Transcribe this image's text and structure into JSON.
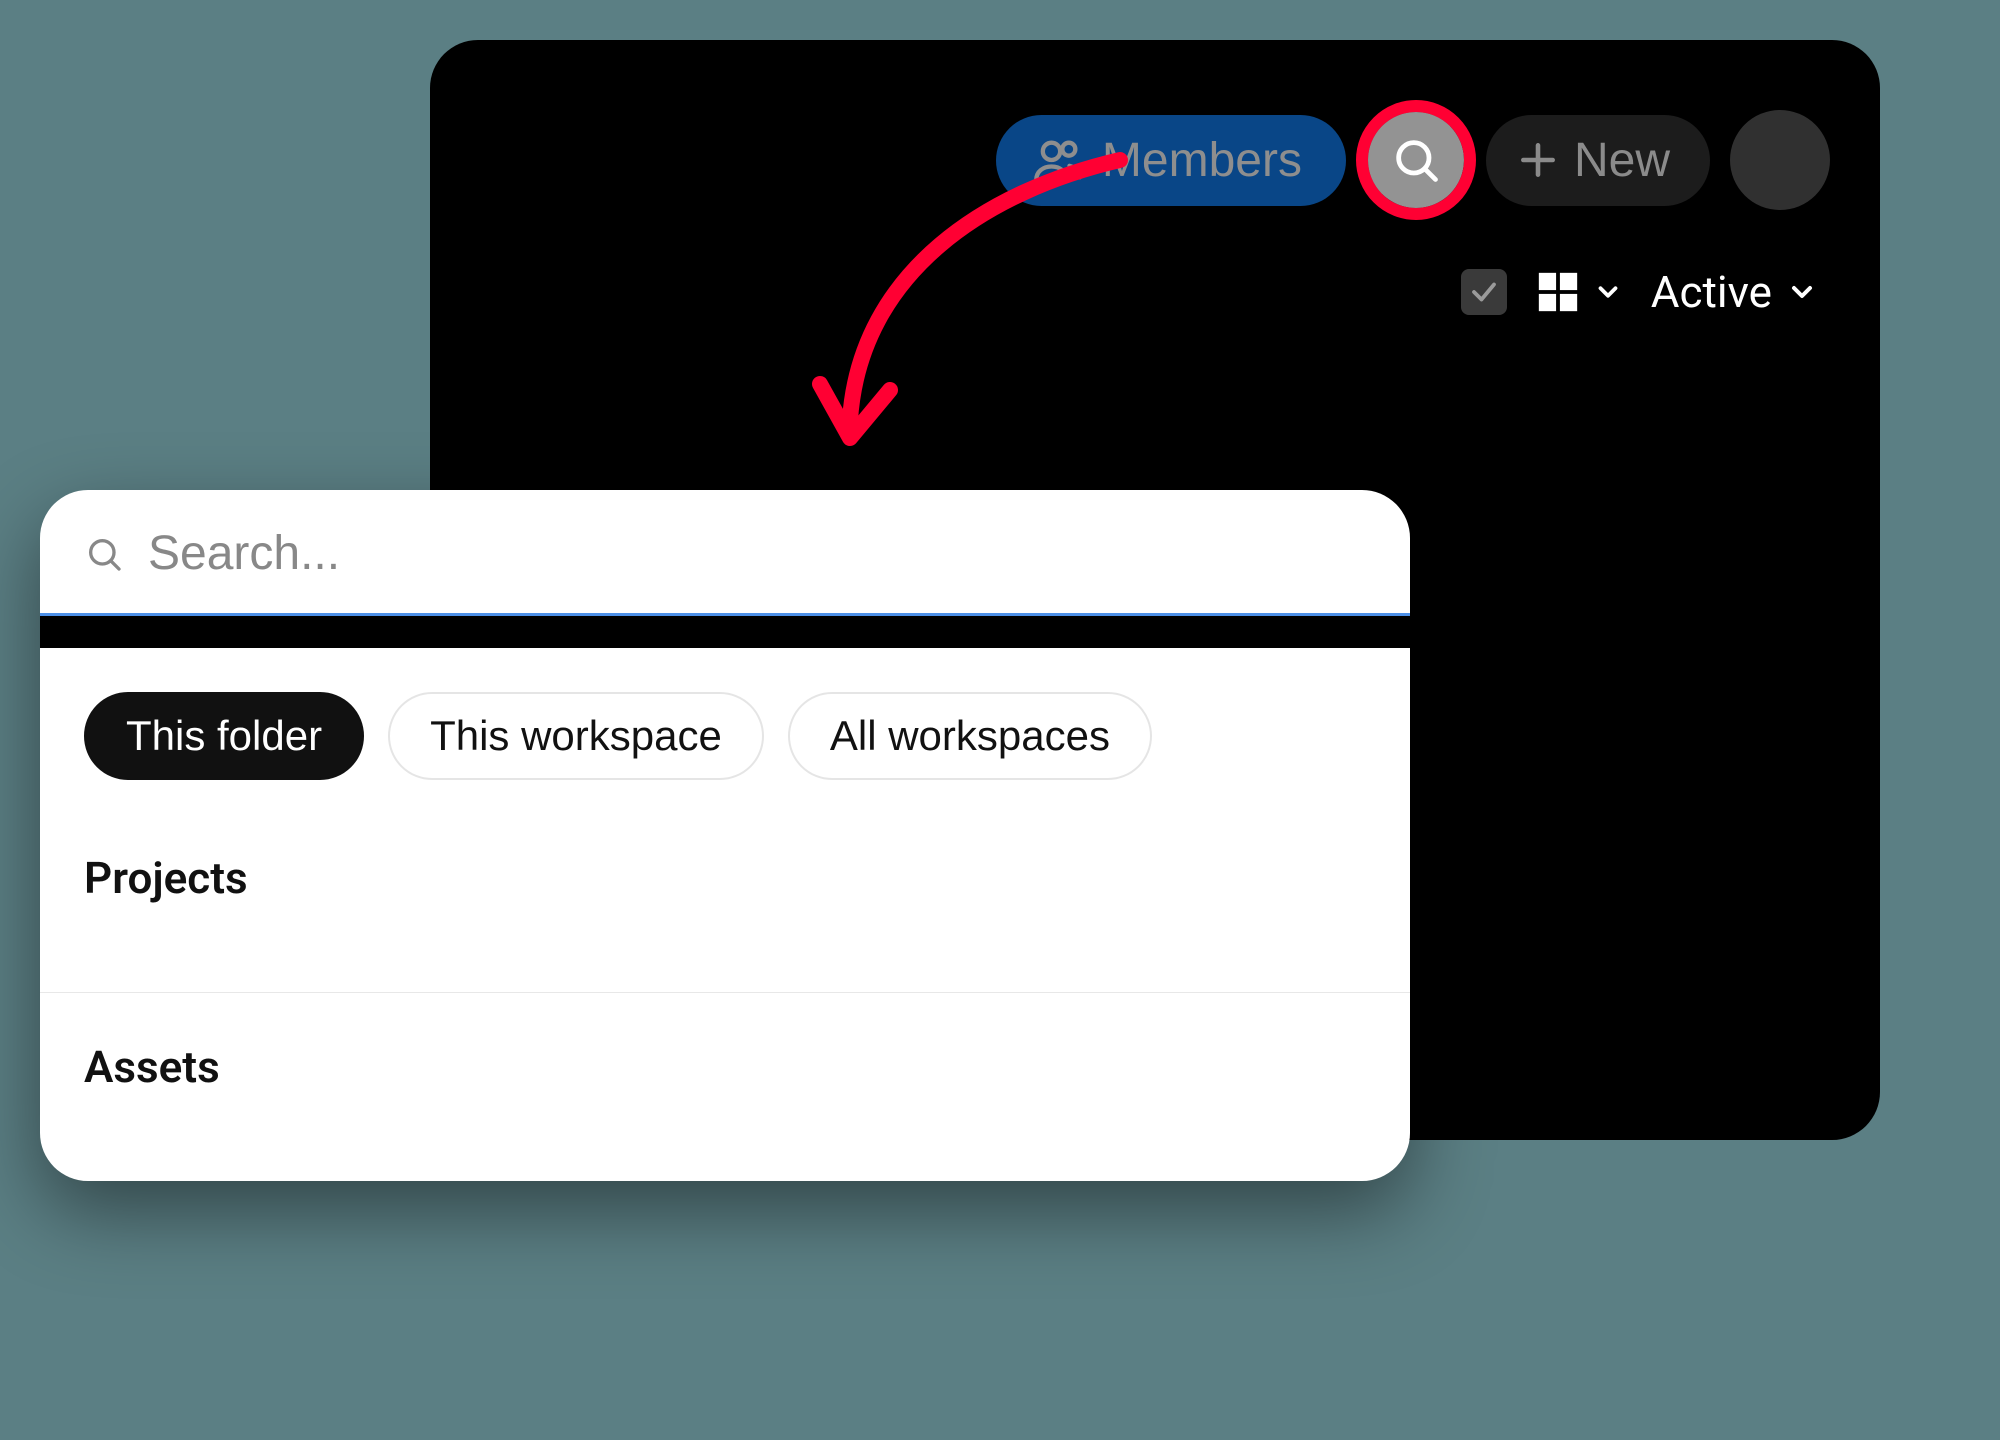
{
  "topbar": {
    "members_label": "Members",
    "new_label": "New"
  },
  "controls": {
    "status_label": "Active"
  },
  "search": {
    "placeholder": "Search...",
    "scopes": {
      "this_folder": "This folder",
      "this_workspace": "This workspace",
      "all_workspaces": "All workspaces"
    },
    "sections": {
      "projects": "Projects",
      "assets": "Assets"
    }
  },
  "annotation": {
    "arrow_color": "#ff0033"
  }
}
